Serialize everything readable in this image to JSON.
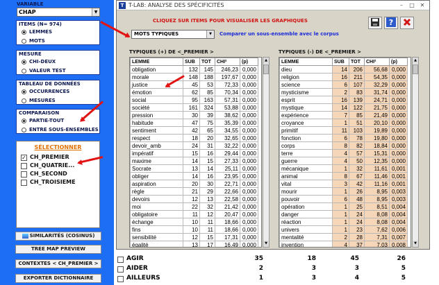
{
  "left_panel": {
    "variable_label": "VARIABLE",
    "variable_value": "CHAP",
    "items_title": "ITEMS (N= 974)",
    "items_options": [
      {
        "label": "LEMMES",
        "selected": true
      },
      {
        "label": "MOTS",
        "selected": false
      }
    ],
    "mesure_title": "MESURE",
    "mesure_options": [
      {
        "label": "CHI-DEUX",
        "selected": true
      },
      {
        "label": "VALEUR TEST",
        "selected": false
      }
    ],
    "tableau_title": "TABLEAU DE DONNÉES",
    "tableau_options": [
      {
        "label": "OCCURRENCES",
        "selected": true
      },
      {
        "label": "MESURES",
        "selected": false
      }
    ],
    "comparaison_title": "COMPARAISON",
    "comparaison_options": [
      {
        "label": "PARTIE-TOUT",
        "selected": true
      },
      {
        "label": "ENTRE SOUS-ENSEMBLES",
        "selected": false
      }
    ],
    "select_title": "SÉLECTIONNER",
    "select_items": [
      {
        "label": "CH_PREMIER",
        "checked": true
      },
      {
        "label": "CH_QUATRIE...",
        "checked": false
      },
      {
        "label": "CH_SECOND",
        "checked": false
      },
      {
        "label": "CH_TROISIEME",
        "checked": false
      }
    ],
    "buttons": [
      "SIMILARITÉS (COSINUS)",
      "TREE MAP PREVIEW",
      "CONTEXTES  < CH_PREMIER >",
      "EXPORTER DICTIONNAIRE"
    ]
  },
  "dialog": {
    "title": "T-LAB: ANALYSE DES SPÉCIFICITÉS",
    "title_icon": "T",
    "click_hint": "CLIQUEZ SUR ITEMS POUR VISUALISER LES GRAPHIQUES",
    "mode_select": "MOTS TYPIQUES",
    "compare_link": "Comparer un sous-ensemble avec le corpus",
    "tools": [
      "save-icon",
      "help-icon",
      "close-icon"
    ],
    "plus_caption": "TYPIQUES (+) DE <_PREMIER >",
    "minus_caption": "TYPIQUES (-) DE <_PREMIER >",
    "columns": [
      "LEMME",
      "SUB",
      "TOT",
      "CHI²",
      "(p)"
    ],
    "plus_rows": [
      [
        "obligation",
        "132",
        "145",
        "246,23",
        "0,000"
      ],
      [
        "morale",
        "148",
        "188",
        "197,67",
        "0,000"
      ],
      [
        "justice",
        "45",
        "53",
        "72,33",
        "0,000"
      ],
      [
        "émotion",
        "62",
        "85",
        "70,34",
        "0,000"
      ],
      [
        "social",
        "95",
        "163",
        "57,31",
        "0,000"
      ],
      [
        "société",
        "161",
        "324",
        "53,88",
        "0,000"
      ],
      [
        "pression",
        "30",
        "39",
        "38,62",
        "0,000"
      ],
      [
        "habitude",
        "47",
        "75",
        "35,39",
        "0,000"
      ],
      [
        "sentiment",
        "42",
        "65",
        "34,55",
        "0,000"
      ],
      [
        "respect",
        "18",
        "20",
        "32,65",
        "0,000"
      ],
      [
        "devoir_amb",
        "24",
        "31",
        "32,22",
        "0,000"
      ],
      [
        "impératif",
        "15",
        "16",
        "29,44",
        "0,000"
      ],
      [
        "maxime",
        "14",
        "15",
        "27,33",
        "0,000"
      ],
      [
        "Socrate",
        "13",
        "14",
        "25,11",
        "0,000"
      ],
      [
        "obliger",
        "14",
        "16",
        "23,95",
        "0,000"
      ],
      [
        "aspiration",
        "20",
        "30",
        "22,71",
        "0,000"
      ],
      [
        "règle",
        "21",
        "29",
        "22,66",
        "0,000"
      ],
      [
        "devoirs",
        "12",
        "13",
        "22,58",
        "0,000"
      ],
      [
        "moi",
        "22",
        "32",
        "21,42",
        "0,000"
      ],
      [
        "obligatoire",
        "11",
        "12",
        "20,47",
        "0,000"
      ],
      [
        "échange",
        "10",
        "11",
        "18,66",
        "0,000"
      ],
      [
        "fins",
        "10",
        "11",
        "18,66",
        "0,000"
      ],
      [
        "sensibilité",
        "12",
        "15",
        "17,31",
        "0,000"
      ],
      [
        "égalité",
        "13",
        "17",
        "16,49",
        "0,000"
      ]
    ],
    "minus_rows": [
      [
        "dieu",
        "14",
        "206",
        "56,68",
        "0,000"
      ],
      [
        "religion",
        "16",
        "211",
        "54,35",
        "0,000"
      ],
      [
        "science",
        "6",
        "107",
        "32,29",
        "0,000"
      ],
      [
        "mysticisme",
        "2",
        "83",
        "31,74",
        "0,000"
      ],
      [
        "esprit",
        "16",
        "139",
        "24,71",
        "0,000"
      ],
      [
        "mystique",
        "14",
        "122",
        "21,75",
        "0,000"
      ],
      [
        "expérience",
        "7",
        "85",
        "21,49",
        "0,000"
      ],
      [
        "croyance",
        "1",
        "51",
        "20,10",
        "0,000"
      ],
      [
        "primitif",
        "11",
        "103",
        "19,89",
        "0,000"
      ],
      [
        "fonction",
        "6",
        "78",
        "19,80",
        "0,000"
      ],
      [
        "corps",
        "8",
        "82",
        "18,84",
        "0,000"
      ],
      [
        "terre",
        "4",
        "57",
        "15,31",
        "0,000"
      ],
      [
        "guerre",
        "4",
        "50",
        "12,35",
        "0,000"
      ],
      [
        "mécanique",
        "1",
        "32",
        "11,61",
        "0,001"
      ],
      [
        "animal",
        "8",
        "67",
        "11,46",
        "0,001"
      ],
      [
        "vital",
        "3",
        "42",
        "11,16",
        "0,001"
      ],
      [
        "mourir",
        "1",
        "26",
        "8,95",
        "0,003"
      ],
      [
        "pouvoir",
        "6",
        "48",
        "8,95",
        "0,003"
      ],
      [
        "opération",
        "1",
        "25",
        "8,51",
        "0,004"
      ],
      [
        "danger",
        "1",
        "24",
        "8,08",
        "0,004"
      ],
      [
        "réaction",
        "1",
        "24",
        "8,08",
        "0,004"
      ],
      [
        "univers",
        "1",
        "23",
        "7,62",
        "0,006"
      ],
      [
        "mentalité",
        "2",
        "28",
        "7,31",
        "0,007"
      ],
      [
        "invention",
        "4",
        "37",
        "7,03",
        "0,008"
      ]
    ]
  },
  "background_table": {
    "rows": [
      {
        "label": "AGIR",
        "values": [
          "35",
          "18",
          "45",
          "26"
        ]
      },
      {
        "label": "AIDER",
        "values": [
          "2",
          "3",
          "3",
          "5"
        ]
      },
      {
        "label": "AILLEURS",
        "values": [
          "1",
          "3",
          "4",
          "5"
        ]
      }
    ]
  },
  "colors": {
    "panel_blue": "#1d6ef5",
    "annotation_red": "#e21313",
    "highlight_peach": "#f6d6b8",
    "link_blue": "#1a2bd8"
  }
}
